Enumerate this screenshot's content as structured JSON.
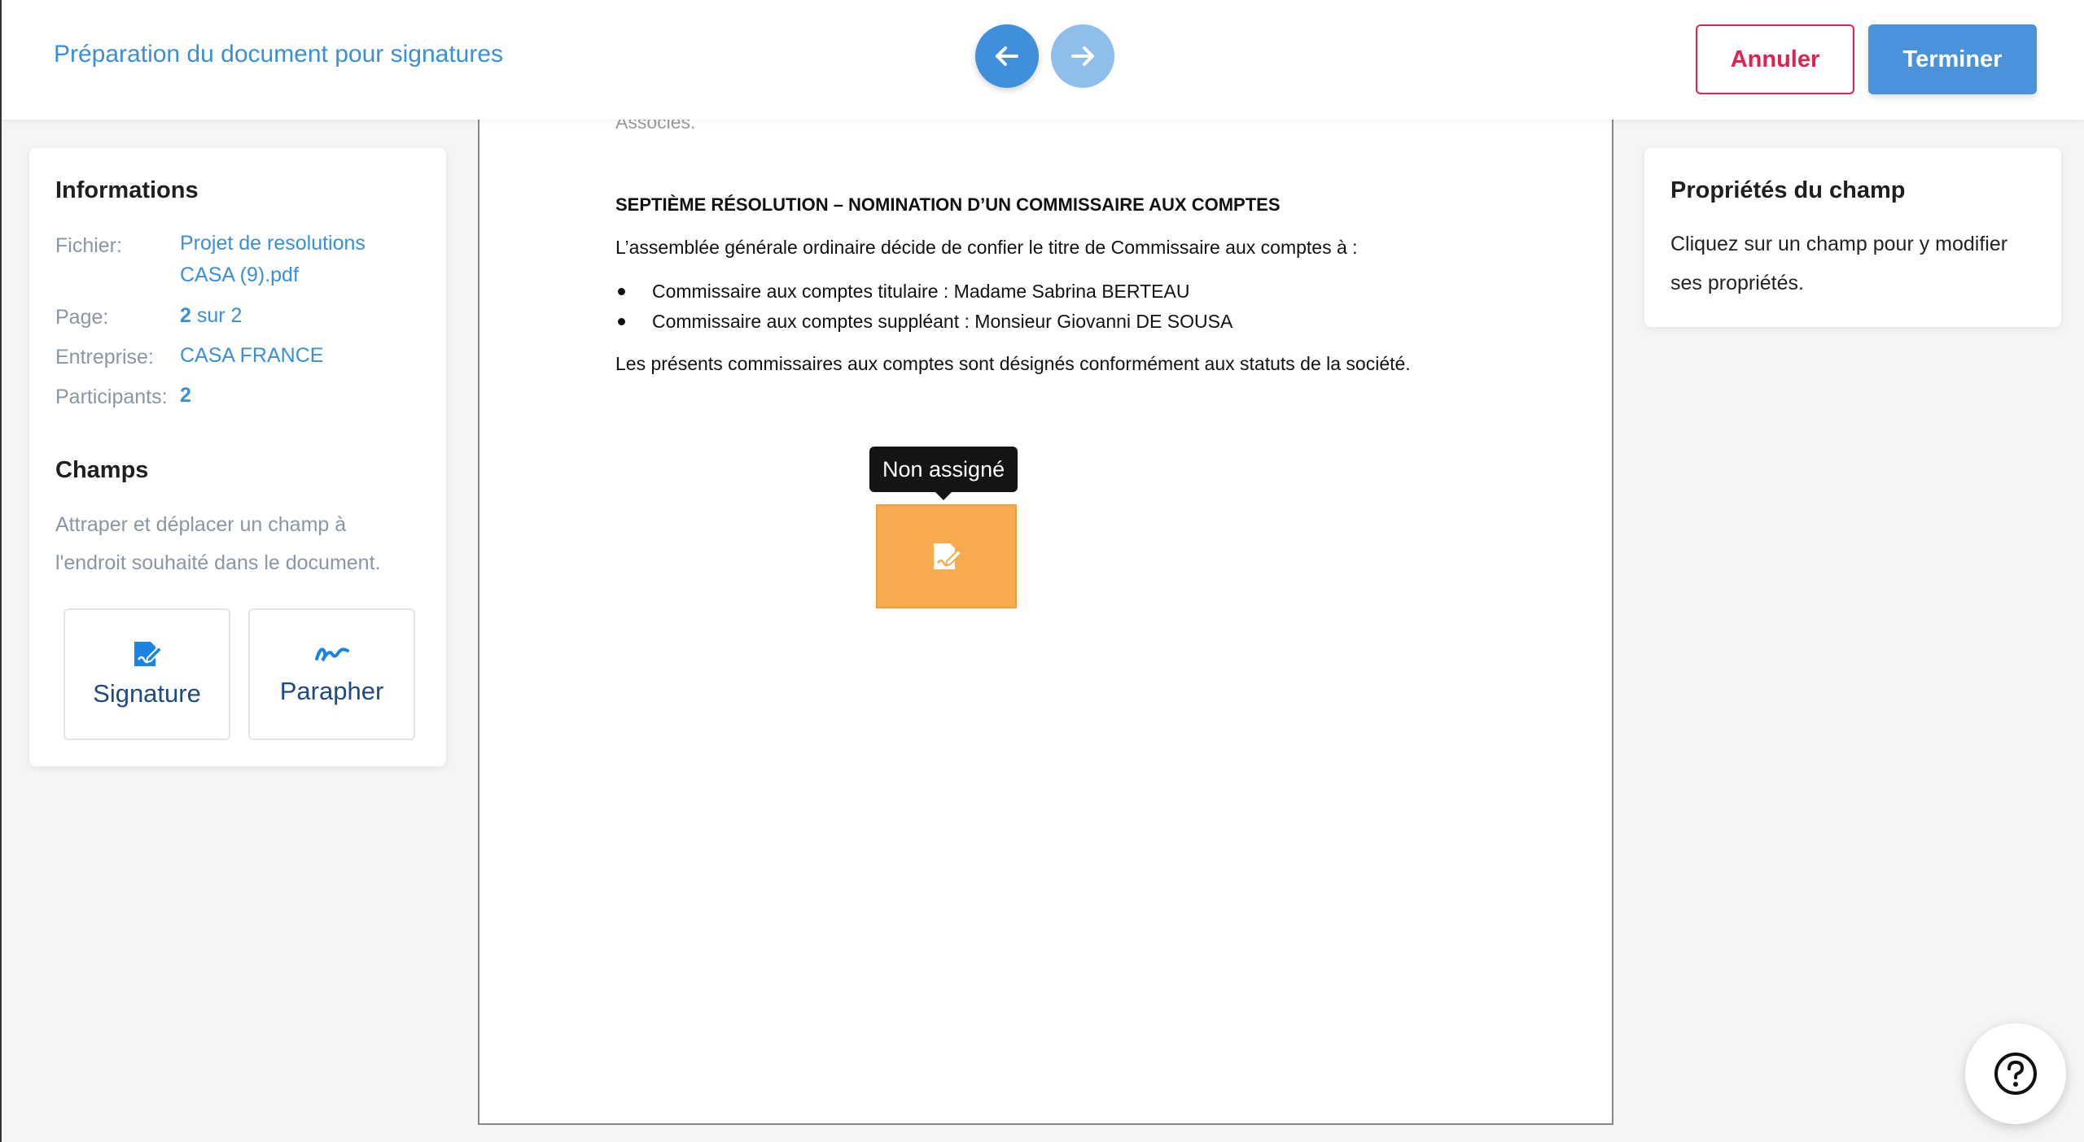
{
  "header": {
    "title": "Préparation du document pour signatures",
    "prev_icon": "arrow-left-icon",
    "next_icon": "arrow-right-icon",
    "cancel_label": "Annuler",
    "finish_label": "Terminer"
  },
  "info": {
    "heading": "Informations",
    "file_label": "Fichier:",
    "file_value_line1": "Projet de resolutions",
    "file_value_line2": "CASA (9).pdf",
    "page_label": "Page:",
    "page_current": "2",
    "page_rest": " sur 2",
    "company_label": "Entreprise:",
    "company_value": "CASA FRANCE",
    "participants_label": "Participants:",
    "participants_value": "2"
  },
  "champs": {
    "heading": "Champs",
    "description": "Attraper et déplacer un champ à l'endroit souhaité dans le document.",
    "signature_label": "Signature",
    "paraph_label": "Parapher"
  },
  "document": {
    "cut_text": "Associés.",
    "heading": "SEPTIÈME RÉSOLUTION – NOMINATION D’UN COMMISSAIRE AUX COMPTES",
    "intro": "L’assemblée générale ordinaire décide de confier le titre de Commissaire aux comptes à :",
    "bullets": [
      "Commissaire aux comptes titulaire : Madame Sabrina BERTEAU",
      "Commissaire aux comptes suppléant : Monsieur Giovanni DE SOUSA"
    ],
    "closing": "Les présents commissaires aux comptes sont désignés conformément aux statuts de la société.",
    "tooltip": "Non assigné"
  },
  "properties": {
    "heading": "Propriétés du champ",
    "description": "Cliquez sur un champ pour y modifier ses propriétés."
  },
  "colors": {
    "accent": "#3a8fd8",
    "danger": "#e0234e",
    "field_fill": "#f7ab4e"
  }
}
